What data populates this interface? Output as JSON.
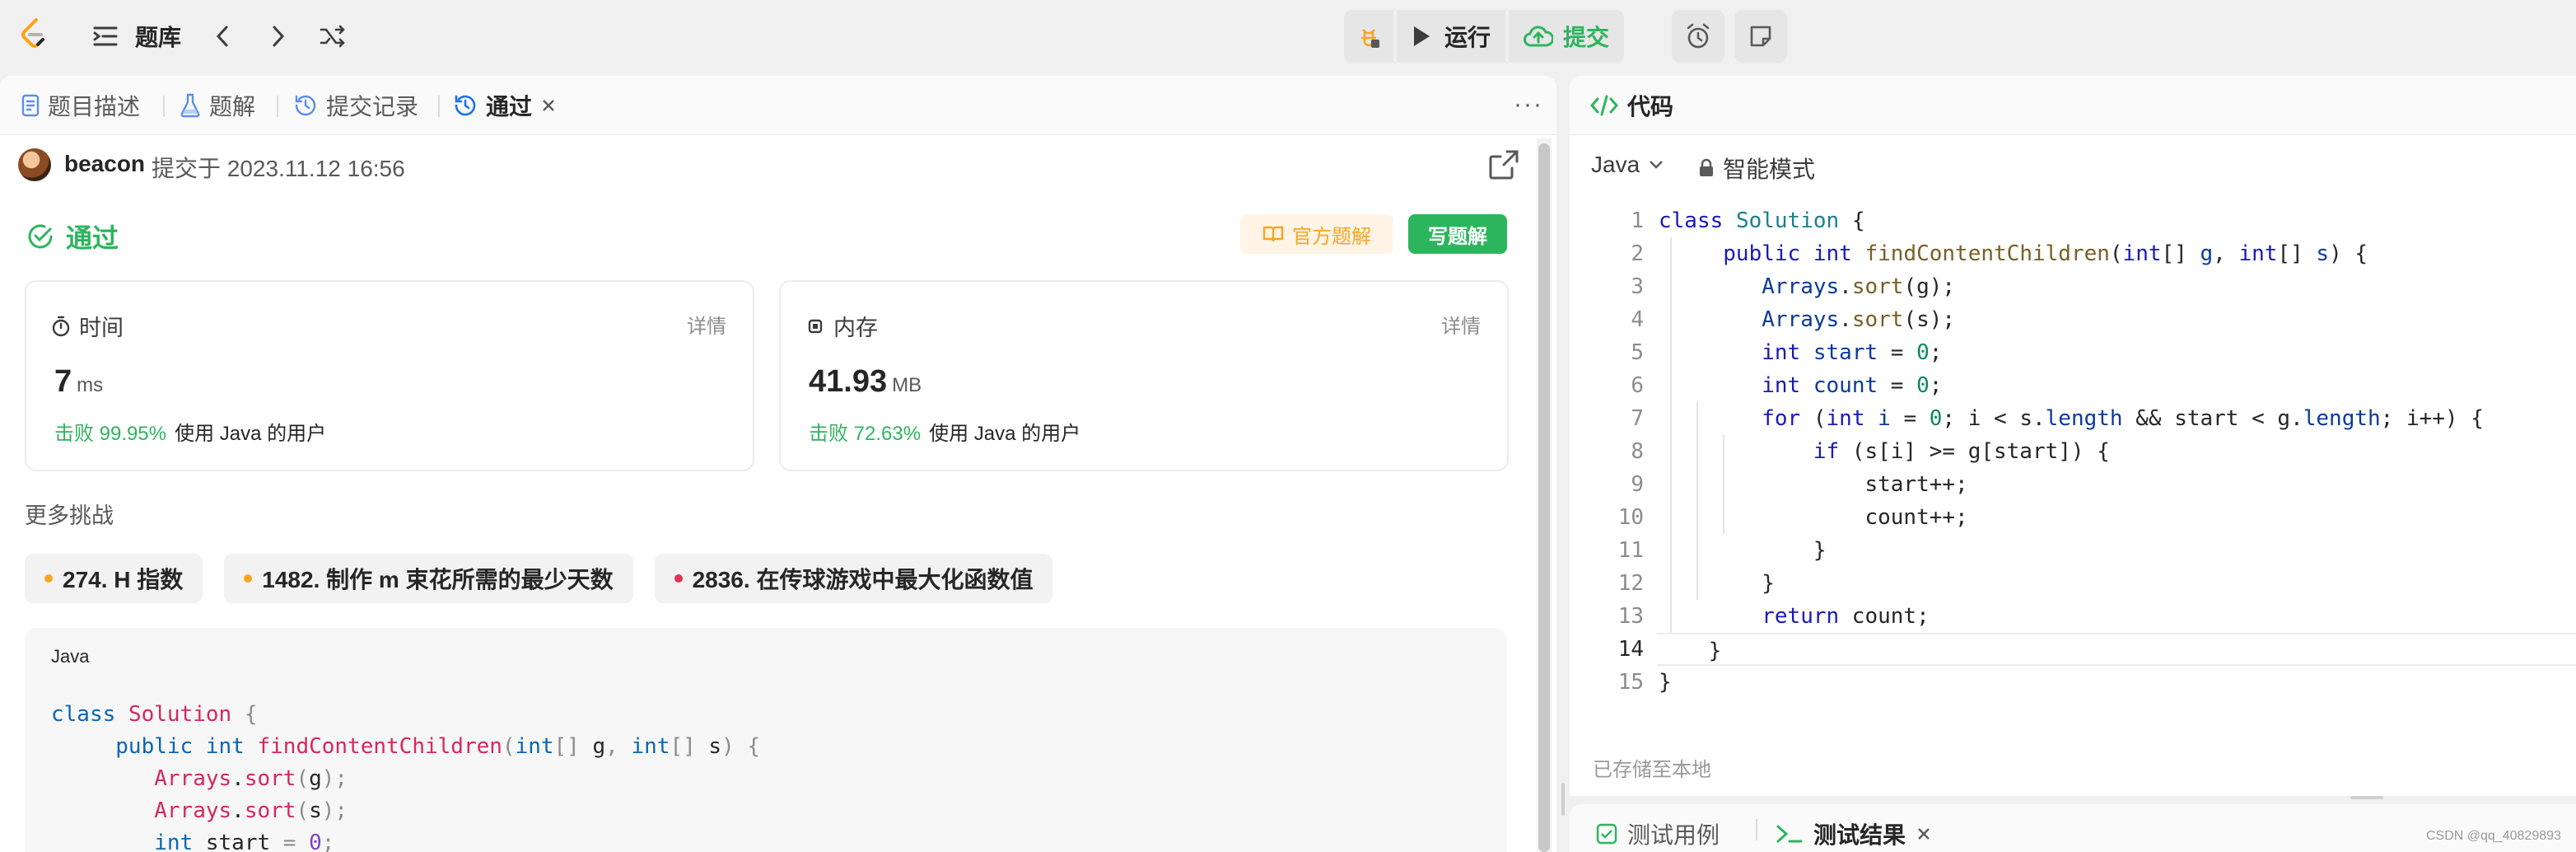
{
  "topbar": {
    "tiku_label": "题库",
    "run_label": "运行",
    "submit_label": "提交"
  },
  "left_tabs": [
    {
      "label": "题目描述",
      "icon": "document-icon"
    },
    {
      "label": "题解",
      "icon": "flask-icon"
    },
    {
      "label": "提交记录",
      "icon": "history-icon"
    },
    {
      "label": "通过",
      "icon": "history-icon"
    }
  ],
  "submission": {
    "username": "beacon",
    "info": "提交于 2023.11.12 16:56"
  },
  "result": {
    "status": "通过",
    "official_solution_label": "官方题解",
    "write_solution_label": "写题解"
  },
  "stats": {
    "time": {
      "label": "时间",
      "detail": "详情",
      "value": "7",
      "unit": "ms",
      "beat_pct": "击败 99.95%",
      "beat_text": "使用 Java 的用户"
    },
    "memory": {
      "label": "内存",
      "detail": "详情",
      "value": "41.93",
      "unit": "MB",
      "beat_pct": "击败 72.63%",
      "beat_text": "使用 Java 的用户"
    }
  },
  "more_challenges": {
    "label": "更多挑战",
    "items": [
      {
        "title": "274. H 指数",
        "color": "#f5a623"
      },
      {
        "title": "1482. 制作 m 束花所需的最少天数",
        "color": "#f5a623"
      },
      {
        "title": "2836. 在传球游戏中最大化函数值",
        "color": "#e0334f"
      }
    ]
  },
  "submitted_code": {
    "language": "Java",
    "lines": [
      "class Solution {",
      "    public int findContentChildren(int[] g, int[] s) {",
      "        Arrays.sort(g);",
      "        Arrays.sort(s);",
      "        int start = 0;"
    ]
  },
  "editor": {
    "title": "代码",
    "language": "Java",
    "mode": "智能模式",
    "saved_note": "已存储至本地",
    "line_numbers": [
      "1",
      "2",
      "3",
      "4",
      "5",
      "6",
      "7",
      "8",
      "9",
      "10",
      "11",
      "12",
      "13",
      "14",
      "15"
    ],
    "current_line": 14
  },
  "bottom_tabs": [
    {
      "label": "测试用例",
      "icon": "checkbox-icon"
    },
    {
      "label": "测试结果",
      "icon": "terminal-icon"
    }
  ],
  "watermark": "CSDN @qq_40829893",
  "colors": {
    "success": "#2db55d",
    "official_bg": "#fff4e5",
    "official_text": "#f5a623"
  }
}
